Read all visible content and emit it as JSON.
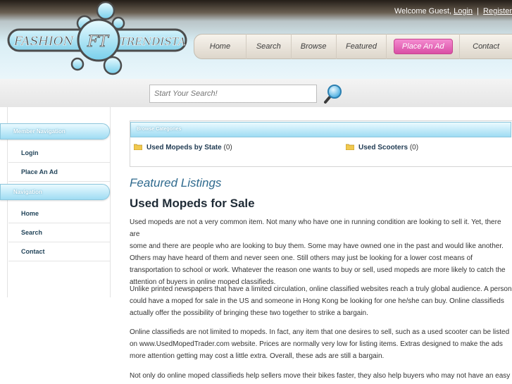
{
  "header": {
    "welcome_text": "Welcome Guest,",
    "login_link": "Login",
    "separator": "|",
    "register_link": "Register",
    "logo_text_left": "FASHION",
    "logo_text_right": "TRENDISTA",
    "logo_monogram": "FT"
  },
  "nav": {
    "items": [
      {
        "label": "Home"
      },
      {
        "label": "Search"
      },
      {
        "label": "Browse"
      },
      {
        "label": "Featured"
      },
      {
        "label": "Place An Ad"
      },
      {
        "label": "Contact"
      }
    ]
  },
  "search": {
    "placeholder": "Start Your Search!",
    "button_icon": "magnifier-icon"
  },
  "sidebar": {
    "member_heading": "Member Navigation",
    "member_items": [
      {
        "label": "Login"
      },
      {
        "label": "Place An Ad"
      }
    ],
    "nav_heading": "Navigation",
    "nav_items": [
      {
        "label": "Home"
      },
      {
        "label": "Search"
      },
      {
        "label": "Contact"
      }
    ]
  },
  "categories": {
    "heading": "Browse Categories",
    "items": [
      {
        "label": "Used Mopeds by State",
        "count": "(0)",
        "icon": "folder-icon"
      },
      {
        "label": "Used Scooters",
        "count": "(0)",
        "icon": "folder-icon"
      }
    ]
  },
  "content": {
    "featured_heading": "Featured Listings",
    "title": "Used Mopeds for Sale",
    "paragraphs": [
      [
        "Used mopeds are not a very common item. Not many who have one in running condition are looking to sell it. Yet, there are",
        "some and there are people who are looking to buy them. Some may have owned one in the past and would like another.",
        "Others may have heard of them and never seen one. Still others may just be looking for a lower cost means of",
        "transportation to school or work. Whatever the reason one wants to buy or sell, used mopeds are more likely to catch the",
        "attention of buyers in online moped classifieds."
      ],
      [
        "Unlike printed newspapers that have a limited circulation, online classified websites reach a truly global audience. A person",
        "could have a moped for sale in the US and someone in Hong Kong be looking for one he/she can buy. Online classifieds",
        "actually offer the possibility of bringing these two together to strike a bargain."
      ],
      [
        "Online classifieds are not limited to mopeds. In fact, any item that one desires to sell, such as a used scooter can be listed",
        "on www.UsedMopedTrader.com website. Prices are normally very low for listing items. Extras designed to make the ads",
        "more attention getting may cost a little extra. Overall, these ads are still a bargain."
      ],
      [
        "Not only do online moped classifieds help sellers move their bikes faster, they also help buyers who may not have an easy"
      ]
    ]
  },
  "colors": {
    "accent_blue": "#9fdcf3",
    "nav_highlight": "#e063b3",
    "heading_blue": "#2f6a8e"
  }
}
